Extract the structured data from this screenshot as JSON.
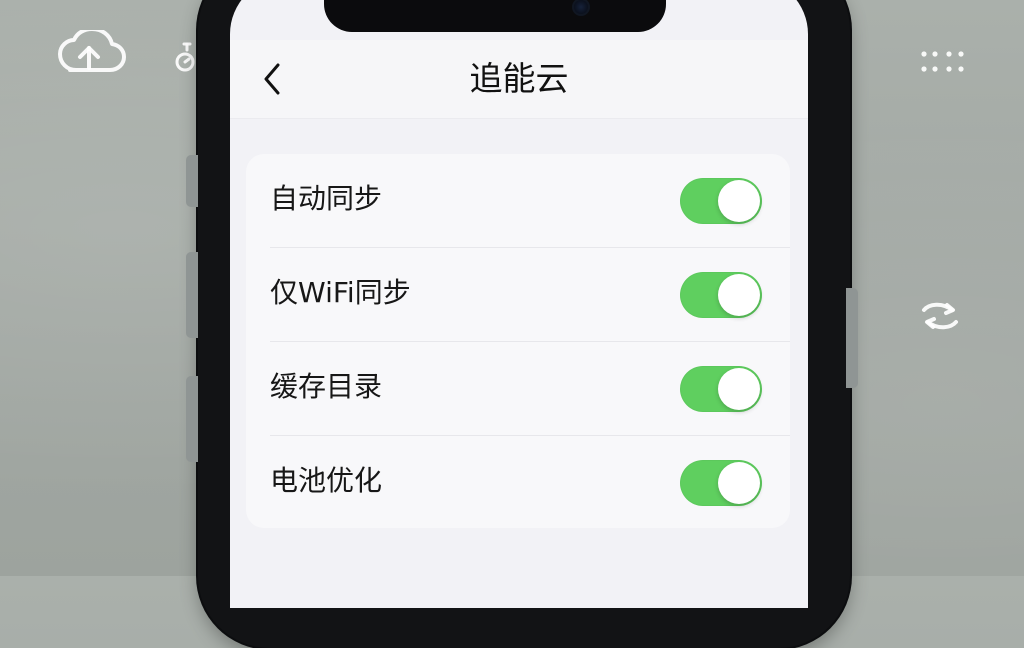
{
  "screen": {
    "title": "追能云"
  },
  "settings": [
    {
      "label": "自动同步",
      "enabled": true
    },
    {
      "label": "仅WiFi同步",
      "enabled": true
    },
    {
      "label": "缓存目录",
      "enabled": true
    },
    {
      "label": "电池优化",
      "enabled": true
    }
  ],
  "icons": {
    "back": "chevron-left-icon",
    "background_left": [
      "cloud-upload-icon",
      "timer-icon"
    ],
    "background_right": [
      "dots-grid-icon",
      "refresh-icon"
    ]
  },
  "colors": {
    "toggle_on": "#5fcf5f",
    "screen_background": "#f2f2f6",
    "card_background": "#f8f8fa"
  }
}
